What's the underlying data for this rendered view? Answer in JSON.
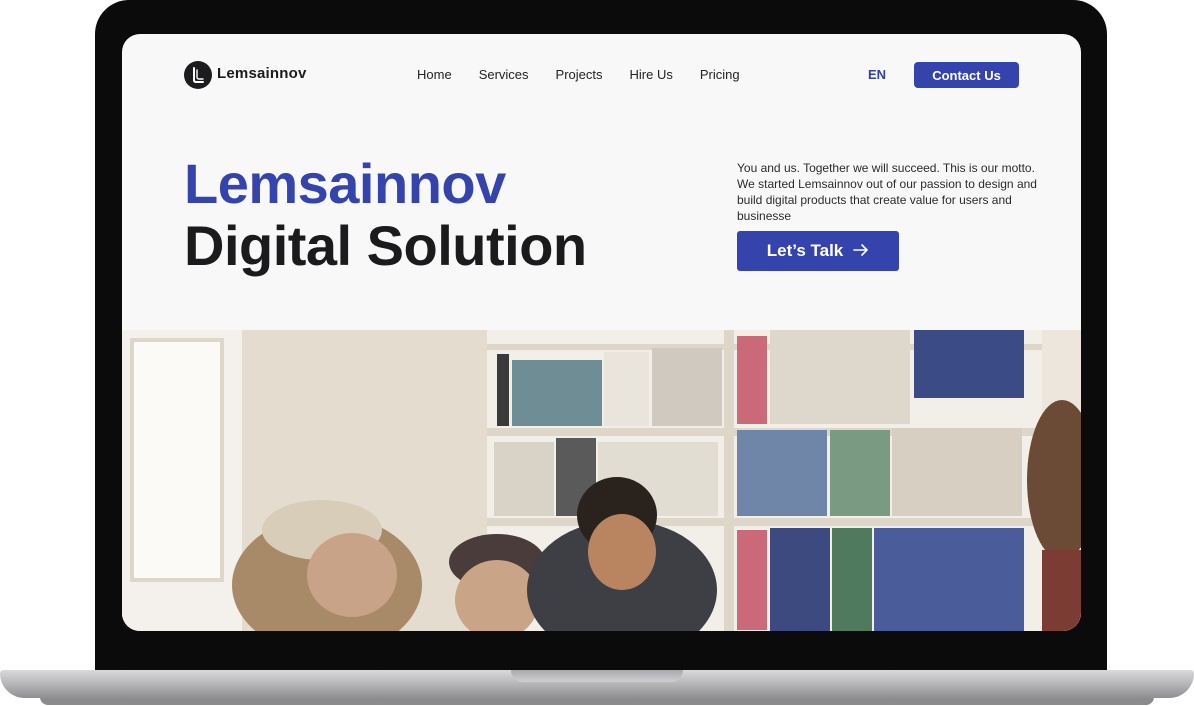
{
  "brand": {
    "name": "Lemsainnov"
  },
  "nav": {
    "items": [
      {
        "label": "Home"
      },
      {
        "label": "Services"
      },
      {
        "label": "Projects"
      },
      {
        "label": "Hire Us"
      },
      {
        "label": "Pricing"
      }
    ],
    "language": "EN",
    "contact_label": "Contact Us"
  },
  "hero": {
    "title_line1": "Lemsainnov",
    "title_line2": "Digital Solution",
    "description": "You and us. Together we will succeed. This is our motto. We started Lemsainnov out of our passion to design and build digital products that create value for users and businesse",
    "cta_label": "Let’s Talk",
    "cta_icon": "arrow-right-icon"
  },
  "colors": {
    "accent": "#3544ad",
    "heading_dark": "#1b1b1d",
    "screen_bg": "#f8f8f9"
  }
}
